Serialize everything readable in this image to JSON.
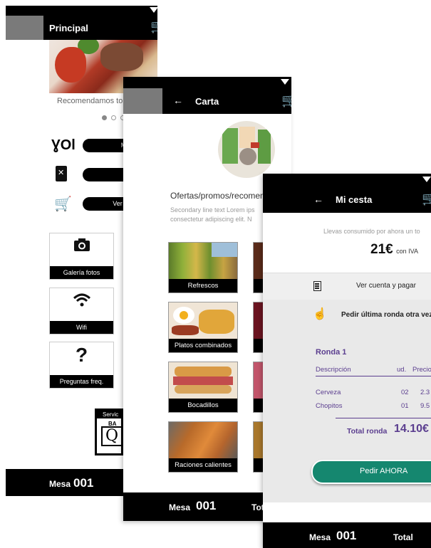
{
  "screen_main": {
    "title": "Principal",
    "banner_caption": "Recomendamos to",
    "menu_buttons": [
      {
        "icon": "cutlery-icon",
        "label": "Me"
      },
      {
        "icon": "menu-book-icon",
        "label": ""
      },
      {
        "icon": "cart-icon",
        "label": "Ver cuen"
      }
    ],
    "tiles": [
      {
        "icon": "camera-icon",
        "label": "Galería fotos"
      },
      {
        "icon": "wifi-icon",
        "label": "Wifi"
      },
      {
        "icon": "question-icon",
        "glyph": "?",
        "label": "Preguntas freq."
      }
    ],
    "logo_text": {
      "line1": "Servic",
      "line2": "BA",
      "line3": "Q"
    },
    "mesa_label": "Mesa",
    "mesa_number": "001"
  },
  "screen_carta": {
    "title": "Carta",
    "back_glyph": "←",
    "section_title": "Ofertas/promos/recomen",
    "secondary_line1": "Secondary line text Lorem ips",
    "secondary_line2": "consectetur adipiscing elit. N",
    "categories": [
      "Refrescos",
      "Platos combinados",
      "Bocadillos",
      "Raciones calientes"
    ],
    "mesa_label": "Mesa",
    "mesa_number": "001",
    "total_label": "Tot"
  },
  "screen_cesta": {
    "title": "Mi cesta",
    "back_glyph": "←",
    "consumed_text": "Llevas consumido por ahora un to",
    "amount": "21€",
    "vat_text": "con IVA",
    "ver_cuenta": "Ver cuenta y pagar",
    "pedir_ultima": "Pedir última ronda otra vez",
    "ronda_title": "Ronda 1",
    "columns": [
      "Descripción",
      "ud.",
      "Precio"
    ],
    "items": [
      {
        "name": "Cerveza",
        "qty": "02",
        "price": "2.3"
      },
      {
        "name": "Chopitos",
        "qty": "01",
        "price": "9.5"
      }
    ],
    "total_label": "Total ronda",
    "total_value": "14.10€",
    "order_button": "Pedir AHORA",
    "mesa_label": "Mesa",
    "mesa_number": "001",
    "bottom_total_label": "Total"
  },
  "colors": {
    "accent_purple": "#5b3e8f",
    "order_teal": "#15876f",
    "appbar": "#000000"
  }
}
